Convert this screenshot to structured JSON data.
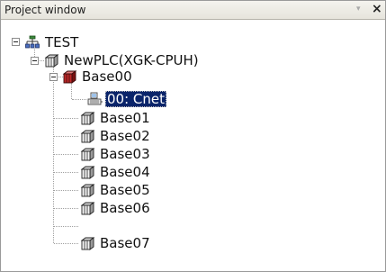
{
  "window": {
    "title": "Project window",
    "menu_arrow": "▾",
    "close_symbol": "×"
  },
  "tree": {
    "project": {
      "label": "TEST",
      "icon": "project-network-icon",
      "expanded": true
    },
    "plc": {
      "label": "NewPLC(XGK-CPUH)",
      "icon": "plc-cpu-icon",
      "expanded": true
    },
    "bases": [
      {
        "label": "Base00",
        "icon": "base-rack-icon",
        "expanded": true,
        "active": true
      },
      {
        "label": "Base01",
        "icon": "base-rack-icon"
      },
      {
        "label": "Base02",
        "icon": "base-rack-icon"
      },
      {
        "label": "Base03",
        "icon": "base-rack-icon"
      },
      {
        "label": "Base04",
        "icon": "base-rack-icon"
      },
      {
        "label": "Base05",
        "icon": "base-rack-icon"
      },
      {
        "label": "Base06",
        "icon": "base-rack-icon"
      },
      {
        "label": "Base07",
        "icon": "base-rack-icon"
      }
    ],
    "modules": [
      {
        "label": "00: Cnet",
        "icon": "cnet-module-icon",
        "selected": true
      }
    ]
  },
  "colors": {
    "selection_bg": "#0a246a",
    "selection_text": "#ffffff",
    "active_base_icon": "#b02020",
    "connector": "#a0a0a0"
  }
}
